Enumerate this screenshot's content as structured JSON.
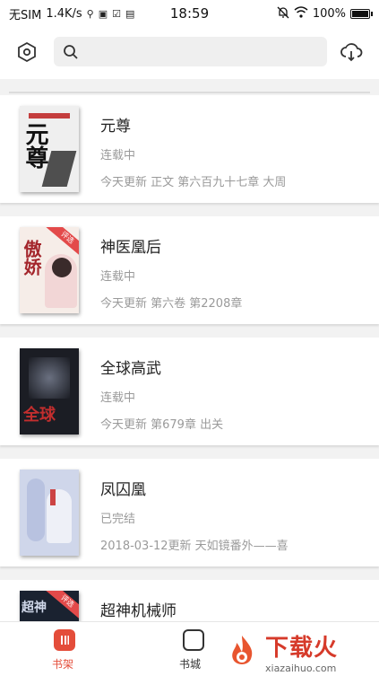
{
  "status_bar": {
    "carrier": "无SIM",
    "speed": "1.4K/s",
    "time": "18:59",
    "battery": "100%"
  },
  "search": {
    "placeholder": ""
  },
  "books": [
    {
      "title": "元尊",
      "status": "连载中",
      "update": "今天更新 正文 第六百九十七章  大周",
      "cover_text": "元尊",
      "cover_bg": "#efefef",
      "cover_ink": "#111111",
      "badge": ""
    },
    {
      "title": "神医凰后",
      "status": "连载中",
      "update": "今天更新 第六卷 第2208章",
      "cover_text": "傲娇",
      "cover_bg": "#f6ede8",
      "cover_ink": "#a4262c",
      "badge": "评选"
    },
    {
      "title": "全球高武",
      "status": "连载中",
      "update": "今天更新 第679章 出关",
      "cover_text": "全球",
      "cover_bg": "#1b1d24",
      "cover_ink": "#c22e2e",
      "badge": ""
    },
    {
      "title": "凤囚凰",
      "status": "已完结",
      "update": "2018-03-12更新  天如镜番外——喜",
      "cover_text": "",
      "cover_bg": "#cfd6ea",
      "cover_ink": "#6b7ab0",
      "badge": ""
    },
    {
      "title": "超神机械师",
      "status": "",
      "update": "",
      "cover_text": "超神",
      "cover_bg": "#1a2230",
      "cover_ink": "#d0d8ea",
      "badge": "评选"
    }
  ],
  "bottom_nav": {
    "items": [
      {
        "label": "书架",
        "active": true
      },
      {
        "label": "书城",
        "active": false
      }
    ]
  },
  "watermark": {
    "main": "下载火",
    "sub": "xiazaihuo.com"
  },
  "colors": {
    "accent": "#e44d3a",
    "muted_text": "#9a9a9a"
  }
}
